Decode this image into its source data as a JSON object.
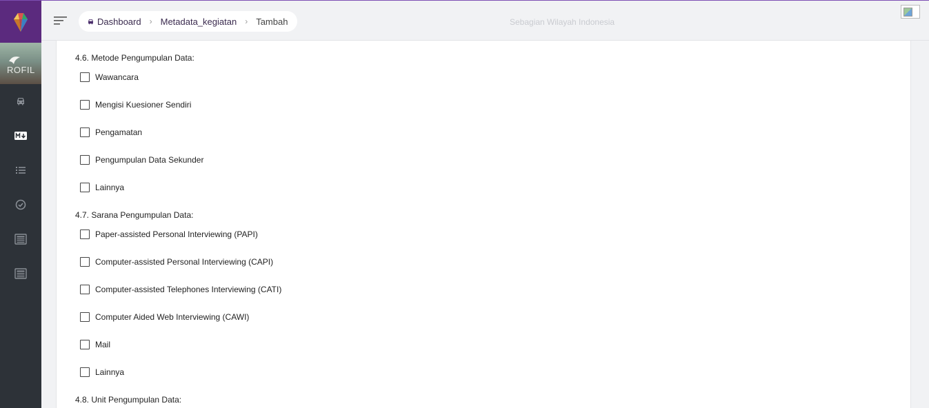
{
  "app": {
    "logo_icon": "gem-logo-icon",
    "banner_text": "ROFIL",
    "colors": {
      "brand": "#5b2a7e",
      "sidebar": "#2d3238",
      "accent_border": "#7d4fb3"
    }
  },
  "sidebar": {
    "items": [
      {
        "icon": "car-icon"
      },
      {
        "icon": "markdown-icon"
      },
      {
        "icon": "list-icon"
      },
      {
        "icon": "check-circle-icon"
      },
      {
        "icon": "newspaper-icon"
      },
      {
        "icon": "newspaper-icon"
      }
    ]
  },
  "header": {
    "menu_icon": "hamburger-icon",
    "breadcrumb": [
      {
        "label": "Dashboard",
        "icon": "car-icon"
      },
      {
        "label": "Metadata_kegiatan"
      },
      {
        "label": "Tambah"
      }
    ],
    "region_text": "Sebagian Wilayah Indonesia"
  },
  "form": {
    "section_46": {
      "label": "4.6. Metode Pengumpulan Data:",
      "options": [
        "Wawancara",
        "Mengisi Kuesioner Sendiri",
        "Pengamatan",
        "Pengumpulan Data Sekunder",
        "Lainnya"
      ]
    },
    "section_47": {
      "label": "4.7. Sarana Pengumpulan Data:",
      "options": [
        "Paper-assisted Personal Interviewing (PAPI)",
        "Computer-assisted Personal Interviewing (CAPI)",
        "Computer-assisted Telephones Interviewing (CATI)",
        "Computer Aided Web Interviewing (CAWI)",
        "Mail",
        "Lainnya"
      ]
    },
    "section_48": {
      "label": "4.8. Unit Pengumpulan Data:"
    }
  }
}
